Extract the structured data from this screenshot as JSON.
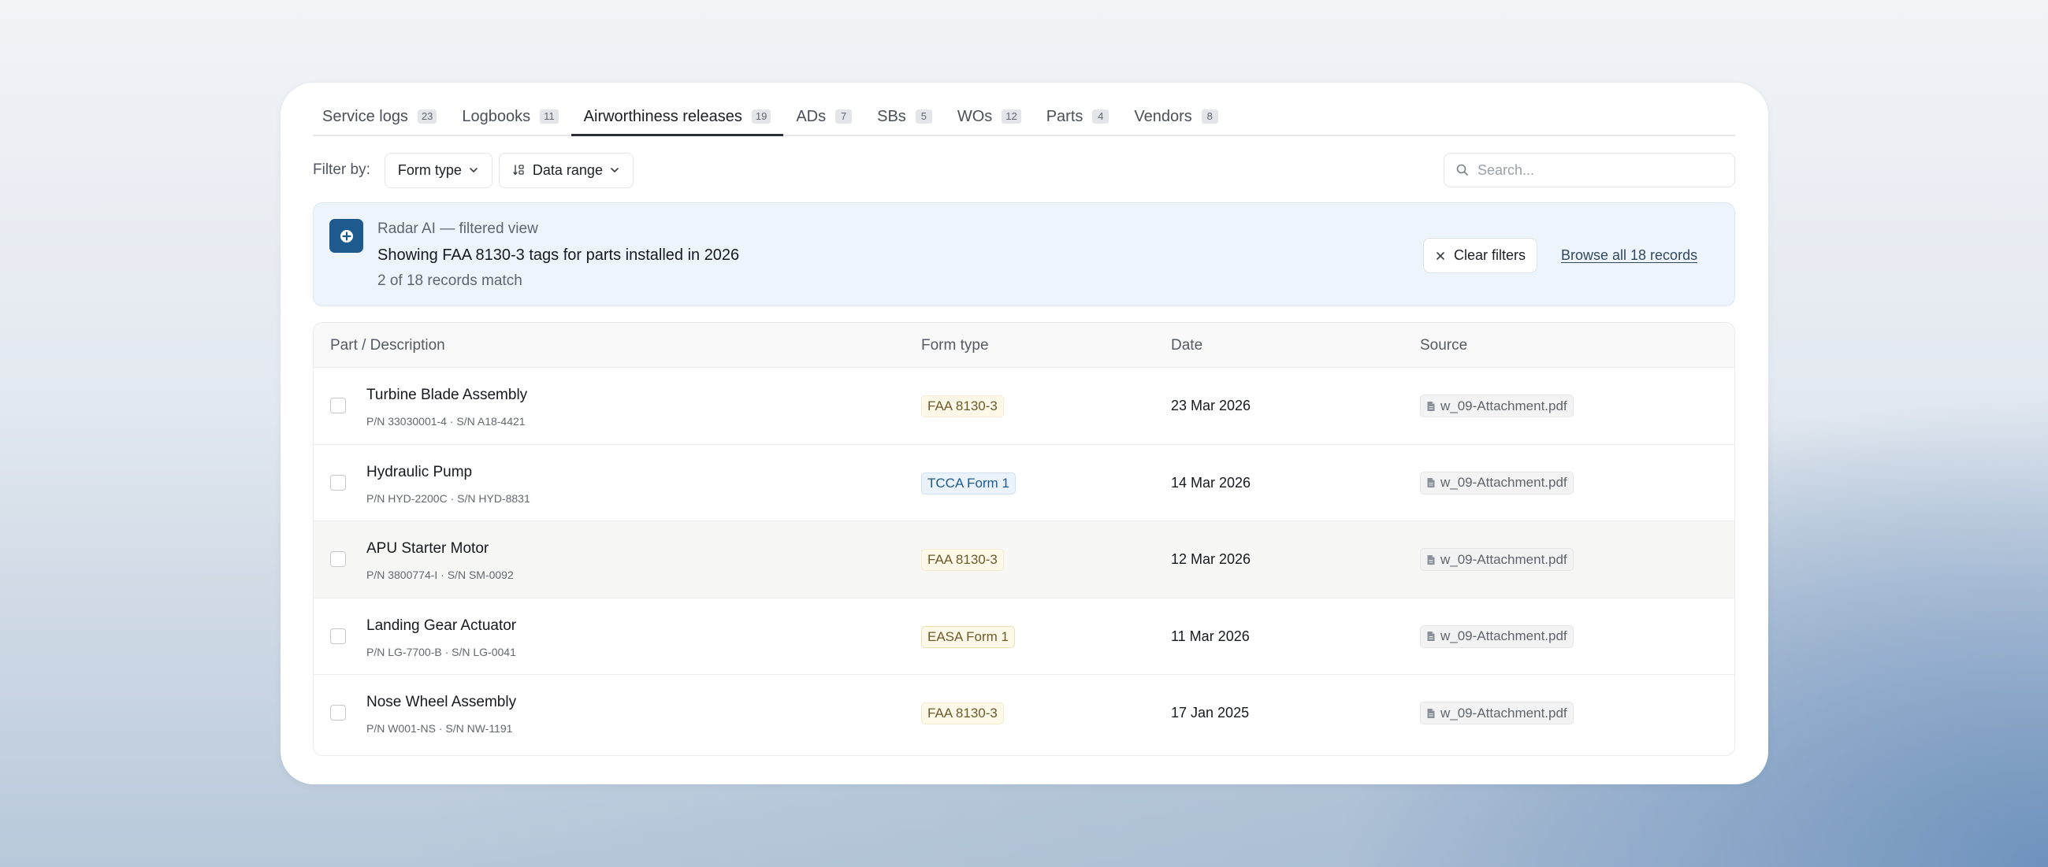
{
  "tabs": [
    {
      "label": "Service logs",
      "count": "23",
      "active": false
    },
    {
      "label": "Logbooks",
      "count": "11",
      "active": false
    },
    {
      "label": "Airworthiness releases",
      "count": "19",
      "active": true
    },
    {
      "label": "ADs",
      "count": "7",
      "active": false
    },
    {
      "label": "SBs",
      "count": "5",
      "active": false
    },
    {
      "label": "WOs",
      "count": "12",
      "active": false
    },
    {
      "label": "Parts",
      "count": "4",
      "active": false
    },
    {
      "label": "Vendors",
      "count": "8",
      "active": false
    }
  ],
  "filters": {
    "label": "Filter by:",
    "form_type": "Form type",
    "date_range": "Data range",
    "search_placeholder": "Search..."
  },
  "banner": {
    "title": "Radar AI — filtered view",
    "main": "Showing FAA 8130-3 tags for parts installed in 2026",
    "sub": "2 of 18 records match",
    "clear_label": "Clear filters",
    "browse_label": "Browse all 18 records"
  },
  "table": {
    "headers": {
      "part": "Part / Description",
      "form": "Form type",
      "date": "Date",
      "source": "Source"
    },
    "rows": [
      {
        "name": "Turbine Blade Assembly",
        "meta": "P/N 33030001-4 · S/N A18-4421",
        "form": "FAA 8130-3",
        "form_style": "faa",
        "date": "23 Mar 2026",
        "source": "w_09-Attachment.pdf"
      },
      {
        "name": "Hydraulic Pump",
        "meta": "P/N HYD-2200C · S/N HYD-8831",
        "form": "TCCA Form 1",
        "form_style": "tcca",
        "date": "14 Mar 2026",
        "source": "w_09-Attachment.pdf"
      },
      {
        "name": "APU Starter Motor",
        "meta": "P/N 3800774-I · S/N SM-0092",
        "form": "FAA 8130-3",
        "form_style": "faa",
        "date": "12 Mar 2026",
        "source": "w_09-Attachment.pdf"
      },
      {
        "name": "Landing Gear Actuator",
        "meta": "P/N LG-7700-B · S/N LG-0041",
        "form": "EASA Form 1",
        "form_style": "easa",
        "date": "11 Mar 2026",
        "source": "w_09-Attachment.pdf"
      },
      {
        "name": "Nose Wheel Assembly",
        "meta": "P/N W001-NS · S/N NW-1191",
        "form": "FAA 8130-3",
        "form_style": "faa",
        "date": "17 Jan 2025",
        "source": "w_09-Attachment.pdf"
      }
    ]
  },
  "colors": {
    "accent": "#1f5a8e",
    "banner_bg": "#edf4fc"
  }
}
